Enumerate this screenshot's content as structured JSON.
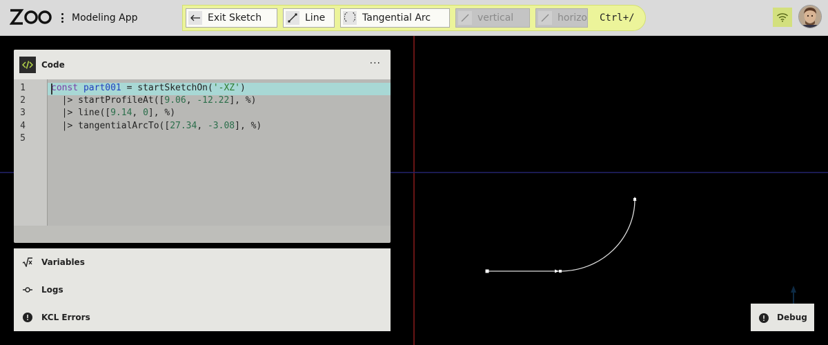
{
  "header": {
    "brand": "ZOO",
    "app_title": "Modeling App"
  },
  "toolbar": {
    "tools": [
      {
        "label": "Exit Sketch",
        "icon": "arrow-left-icon",
        "disabled": false
      },
      {
        "label": "Line",
        "icon": "line-icon",
        "disabled": false
      },
      {
        "label": "Tangential Arc",
        "icon": "tangential-arc-icon",
        "disabled": false
      },
      {
        "label": "vertical",
        "icon": "line-icon",
        "disabled": true
      },
      {
        "label": "horizo",
        "icon": "line-icon",
        "disabled": true
      }
    ],
    "shortcut": "Ctrl+/"
  },
  "code_pane": {
    "title": "Code",
    "menu_label": "···",
    "line_numbers": [
      "1",
      "2",
      "3",
      "4",
      "5"
    ],
    "lines": [
      [
        {
          "t": "c",
          "c": "kw"
        },
        {
          "t": "onst ",
          "c": "kw"
        },
        {
          "t": "part001",
          "c": "vr"
        },
        {
          "t": " = startSketchOn(",
          "c": ""
        },
        {
          "t": "'-XZ'",
          "c": "st"
        },
        {
          "t": ")",
          "c": ""
        }
      ],
      [
        {
          "t": "  |> startProfileAt([",
          "c": ""
        },
        {
          "t": "9.06",
          "c": "nm"
        },
        {
          "t": ", ",
          "c": ""
        },
        {
          "t": "-12.22",
          "c": "nm"
        },
        {
          "t": "], %)",
          "c": ""
        }
      ],
      [
        {
          "t": "  |> line([",
          "c": ""
        },
        {
          "t": "9.14",
          "c": "nm"
        },
        {
          "t": ", ",
          "c": ""
        },
        {
          "t": "0",
          "c": "nm"
        },
        {
          "t": "], %)",
          "c": ""
        }
      ],
      [
        {
          "t": "  |> tangentialArcTo([",
          "c": ""
        },
        {
          "t": "27.34",
          "c": "nm"
        },
        {
          "t": ", ",
          "c": ""
        },
        {
          "t": "-3.08",
          "c": "nm"
        },
        {
          "t": "], %)",
          "c": ""
        }
      ],
      []
    ]
  },
  "panels": {
    "variables": "Variables",
    "logs": "Logs",
    "kcl_errors": "KCL Errors"
  },
  "debug": {
    "label": "Debug"
  },
  "colors": {
    "accent": "#ecf49a",
    "active_line": "#a8d8d5",
    "axis_red": "#8b1a1a",
    "axis_blue": "#1c1c6e",
    "sketch_line": "#ffffff"
  }
}
